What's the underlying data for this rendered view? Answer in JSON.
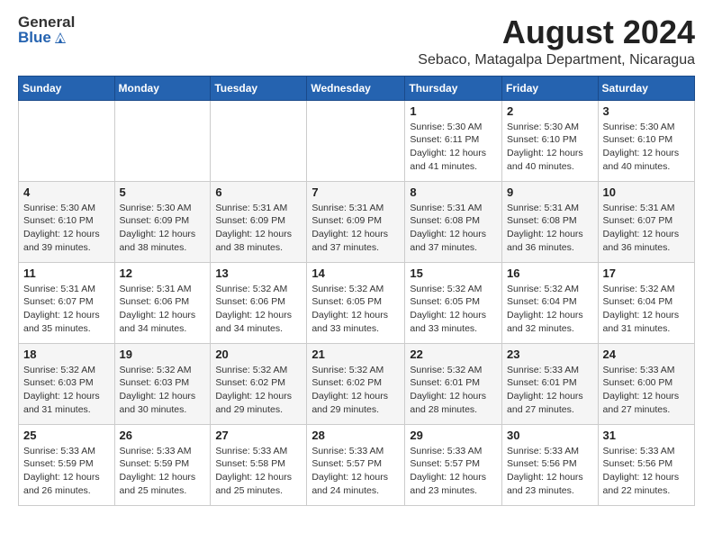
{
  "header": {
    "logo_general": "General",
    "logo_blue": "Blue",
    "main_title": "August 2024",
    "subtitle": "Sebaco, Matagalpa Department, Nicaragua"
  },
  "calendar": {
    "days_of_week": [
      "Sunday",
      "Monday",
      "Tuesday",
      "Wednesday",
      "Thursday",
      "Friday",
      "Saturday"
    ],
    "weeks": [
      [
        {
          "day": "",
          "content": ""
        },
        {
          "day": "",
          "content": ""
        },
        {
          "day": "",
          "content": ""
        },
        {
          "day": "",
          "content": ""
        },
        {
          "day": "1",
          "content": "Sunrise: 5:30 AM\nSunset: 6:11 PM\nDaylight: 12 hours\nand 41 minutes."
        },
        {
          "day": "2",
          "content": "Sunrise: 5:30 AM\nSunset: 6:10 PM\nDaylight: 12 hours\nand 40 minutes."
        },
        {
          "day": "3",
          "content": "Sunrise: 5:30 AM\nSunset: 6:10 PM\nDaylight: 12 hours\nand 40 minutes."
        }
      ],
      [
        {
          "day": "4",
          "content": "Sunrise: 5:30 AM\nSunset: 6:10 PM\nDaylight: 12 hours\nand 39 minutes."
        },
        {
          "day": "5",
          "content": "Sunrise: 5:30 AM\nSunset: 6:09 PM\nDaylight: 12 hours\nand 38 minutes."
        },
        {
          "day": "6",
          "content": "Sunrise: 5:31 AM\nSunset: 6:09 PM\nDaylight: 12 hours\nand 38 minutes."
        },
        {
          "day": "7",
          "content": "Sunrise: 5:31 AM\nSunset: 6:09 PM\nDaylight: 12 hours\nand 37 minutes."
        },
        {
          "day": "8",
          "content": "Sunrise: 5:31 AM\nSunset: 6:08 PM\nDaylight: 12 hours\nand 37 minutes."
        },
        {
          "day": "9",
          "content": "Sunrise: 5:31 AM\nSunset: 6:08 PM\nDaylight: 12 hours\nand 36 minutes."
        },
        {
          "day": "10",
          "content": "Sunrise: 5:31 AM\nSunset: 6:07 PM\nDaylight: 12 hours\nand 36 minutes."
        }
      ],
      [
        {
          "day": "11",
          "content": "Sunrise: 5:31 AM\nSunset: 6:07 PM\nDaylight: 12 hours\nand 35 minutes."
        },
        {
          "day": "12",
          "content": "Sunrise: 5:31 AM\nSunset: 6:06 PM\nDaylight: 12 hours\nand 34 minutes."
        },
        {
          "day": "13",
          "content": "Sunrise: 5:32 AM\nSunset: 6:06 PM\nDaylight: 12 hours\nand 34 minutes."
        },
        {
          "day": "14",
          "content": "Sunrise: 5:32 AM\nSunset: 6:05 PM\nDaylight: 12 hours\nand 33 minutes."
        },
        {
          "day": "15",
          "content": "Sunrise: 5:32 AM\nSunset: 6:05 PM\nDaylight: 12 hours\nand 33 minutes."
        },
        {
          "day": "16",
          "content": "Sunrise: 5:32 AM\nSunset: 6:04 PM\nDaylight: 12 hours\nand 32 minutes."
        },
        {
          "day": "17",
          "content": "Sunrise: 5:32 AM\nSunset: 6:04 PM\nDaylight: 12 hours\nand 31 minutes."
        }
      ],
      [
        {
          "day": "18",
          "content": "Sunrise: 5:32 AM\nSunset: 6:03 PM\nDaylight: 12 hours\nand 31 minutes."
        },
        {
          "day": "19",
          "content": "Sunrise: 5:32 AM\nSunset: 6:03 PM\nDaylight: 12 hours\nand 30 minutes."
        },
        {
          "day": "20",
          "content": "Sunrise: 5:32 AM\nSunset: 6:02 PM\nDaylight: 12 hours\nand 29 minutes."
        },
        {
          "day": "21",
          "content": "Sunrise: 5:32 AM\nSunset: 6:02 PM\nDaylight: 12 hours\nand 29 minutes."
        },
        {
          "day": "22",
          "content": "Sunrise: 5:32 AM\nSunset: 6:01 PM\nDaylight: 12 hours\nand 28 minutes."
        },
        {
          "day": "23",
          "content": "Sunrise: 5:33 AM\nSunset: 6:01 PM\nDaylight: 12 hours\nand 27 minutes."
        },
        {
          "day": "24",
          "content": "Sunrise: 5:33 AM\nSunset: 6:00 PM\nDaylight: 12 hours\nand 27 minutes."
        }
      ],
      [
        {
          "day": "25",
          "content": "Sunrise: 5:33 AM\nSunset: 5:59 PM\nDaylight: 12 hours\nand 26 minutes."
        },
        {
          "day": "26",
          "content": "Sunrise: 5:33 AM\nSunset: 5:59 PM\nDaylight: 12 hours\nand 25 minutes."
        },
        {
          "day": "27",
          "content": "Sunrise: 5:33 AM\nSunset: 5:58 PM\nDaylight: 12 hours\nand 25 minutes."
        },
        {
          "day": "28",
          "content": "Sunrise: 5:33 AM\nSunset: 5:57 PM\nDaylight: 12 hours\nand 24 minutes."
        },
        {
          "day": "29",
          "content": "Sunrise: 5:33 AM\nSunset: 5:57 PM\nDaylight: 12 hours\nand 23 minutes."
        },
        {
          "day": "30",
          "content": "Sunrise: 5:33 AM\nSunset: 5:56 PM\nDaylight: 12 hours\nand 23 minutes."
        },
        {
          "day": "31",
          "content": "Sunrise: 5:33 AM\nSunset: 5:56 PM\nDaylight: 12 hours\nand 22 minutes."
        }
      ]
    ]
  }
}
